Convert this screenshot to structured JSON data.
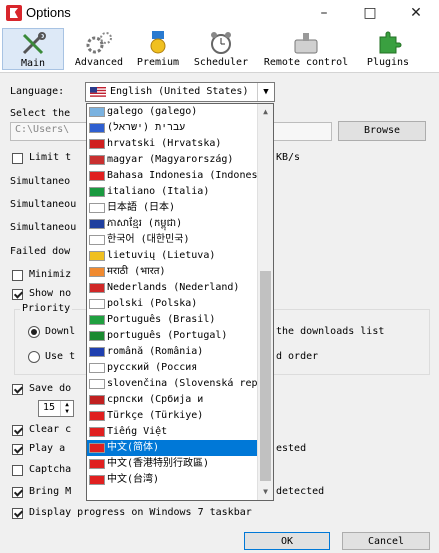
{
  "window": {
    "title": "Options",
    "minimize": "–",
    "maximize": "□",
    "close": "✕"
  },
  "toolbar": {
    "items": [
      {
        "label": "Main",
        "icon": "wrench-icon"
      },
      {
        "label": "Advanced",
        "icon": "gears-icon"
      },
      {
        "label": "Premium",
        "icon": "medal-icon"
      },
      {
        "label": "Scheduler",
        "icon": "alarm-clock-icon"
      },
      {
        "label": "Remote control",
        "icon": "remote-icon"
      },
      {
        "label": "Plugins",
        "icon": "puzzle-icon"
      }
    ]
  },
  "language": {
    "label": "Language:",
    "selected": "English (United States)"
  },
  "folder": {
    "label": "Select the",
    "path": "C:\\Users\\",
    "browse": "Browse"
  },
  "main": {
    "limit_label": "Limit t",
    "limit_suffix": "KB/s",
    "simul1": "Simultaneo",
    "simul2": "Simultaneou",
    "simul3": "Simultaneou",
    "failed": "Failed dow",
    "minimize": "Minimiz",
    "show": "Show no",
    "priority": "Priority",
    "radio1": "Downl",
    "radio1_tail": "the downloads list",
    "radio2": "Use t",
    "radio2_tail": "d order",
    "save": "Save do",
    "spin_value": "15",
    "clear": "Clear c",
    "play": "Play a",
    "play_tail": "ested",
    "captcha": "Captcha",
    "bring": "Bring M",
    "bring_tail": "detected",
    "progress": "Display progress on Windows 7 taskbar"
  },
  "dropdown": {
    "items": [
      {
        "text": "galego (galego)",
        "flag": "#7ab2e0"
      },
      {
        "text": "עברית (ישראל)",
        "flag": "#2f5fd0"
      },
      {
        "text": "hrvatski (Hrvatska)",
        "flag": "#d02020"
      },
      {
        "text": "magyar (Magyarország)",
        "flag": "#c83030"
      },
      {
        "text": "Bahasa Indonesia (Indonesia)",
        "flag": "#e02020"
      },
      {
        "text": "italiano (Italia)",
        "flag": "#1a9a40"
      },
      {
        "text": "日本語 (日本)",
        "flag": "#ffffff"
      },
      {
        "text": "ភាសាខ្មែរ (កម្ពុជា)",
        "flag": "#1f3f9f"
      },
      {
        "text": "한국어 (대한민국)",
        "flag": "#ffffff"
      },
      {
        "text": "lietuvių (Lietuva)",
        "flag": "#f0c020"
      },
      {
        "text": "मराठी (भारत)",
        "flag": "#f08a30"
      },
      {
        "text": "Nederlands (Nederland)",
        "flag": "#d02828"
      },
      {
        "text": "polski (Polska)",
        "flag": "#ffffff"
      },
      {
        "text": "Português (Brasil)",
        "flag": "#20a040"
      },
      {
        "text": "português (Portugal)",
        "flag": "#1a8a30"
      },
      {
        "text": "română (România)",
        "flag": "#1f3faf"
      },
      {
        "text": "русский (Россия",
        "flag": "#ffffff"
      },
      {
        "text": "slovenčina (Slovenská republ",
        "flag": "#ffffff"
      },
      {
        "text": "српски (Србија и",
        "flag": "#c02020"
      },
      {
        "text": "Türkçe (Türkiye)",
        "flag": "#e02020"
      },
      {
        "text": "Tiếng Việt",
        "flag": "#e02020"
      },
      {
        "text": "中文(简体)",
        "flag": "#e02020",
        "selected": true
      },
      {
        "text": "中文(香港特别行政區)",
        "flag": "#e02020"
      },
      {
        "text": "中文(台湾)",
        "flag": "#e02020"
      }
    ]
  },
  "buttons": {
    "ok": "OK",
    "cancel": "Cancel"
  },
  "colors": {
    "selection": "#0078d7",
    "brand": "#d8262c"
  }
}
